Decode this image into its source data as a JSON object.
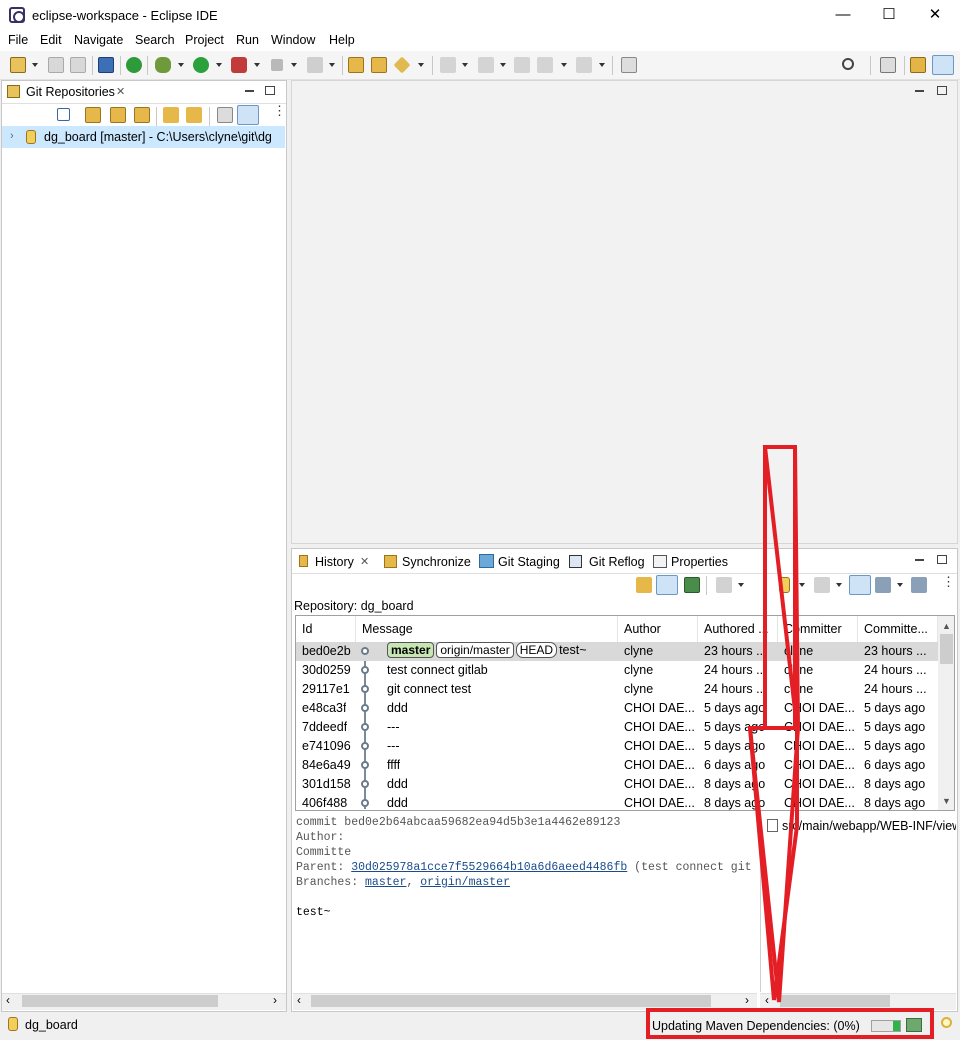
{
  "window": {
    "title": "eclipse-workspace - Eclipse IDE",
    "minimize": "—",
    "maximize": "☐",
    "close": "✕"
  },
  "menu": [
    "File",
    "Edit",
    "Navigate",
    "Search",
    "Project",
    "Run",
    "Window",
    "Help"
  ],
  "left_panel": {
    "tab_title": "Git Repositories",
    "tab_close": "✕",
    "repo_item": "dg_board [master] - C:\\Users\\clyne\\git\\dg"
  },
  "history": {
    "tabs": [
      "History",
      "Synchronize",
      "Git Staging",
      "Git Reflog",
      "Properties"
    ],
    "repository_label": "Repository: dg_board",
    "columns": [
      "Id",
      "Message",
      "Author",
      "Authored ...",
      "Committer",
      "Committe..."
    ],
    "rows": [
      {
        "id": "bed0e2b",
        "refs": [
          "master",
          "origin/master",
          "HEAD"
        ],
        "message": "test~",
        "author": "clyne",
        "authored": "23 hours ...",
        "committer": "clyne",
        "committed": "23 hours ..."
      },
      {
        "id": "30d0259",
        "refs": [],
        "message": "test connect gitlab",
        "author": "clyne",
        "authored": "24 hours ...",
        "committer": "clyne",
        "committed": "24 hours ..."
      },
      {
        "id": "29117e1",
        "refs": [],
        "message": "git connect test",
        "author": "clyne",
        "authored": "24 hours ...",
        "committer": "clyne",
        "committed": "24 hours ..."
      },
      {
        "id": "e48ca3f",
        "refs": [],
        "message": "ddd",
        "author": "CHOI DAE...",
        "authored": "5 days ago",
        "committer": "CHOI DAE...",
        "committed": "5 days ago"
      },
      {
        "id": "7ddeedf",
        "refs": [],
        "message": "---",
        "author": "CHOI DAE...",
        "authored": "5 days ago",
        "committer": "CHOI DAE...",
        "committed": "5 days ago"
      },
      {
        "id": "e741096",
        "refs": [],
        "message": "---",
        "author": "CHOI DAE...",
        "authored": "5 days ago",
        "committer": "CHOI DAE...",
        "committed": "5 days ago"
      },
      {
        "id": "84e6a49",
        "refs": [],
        "message": "ffff",
        "author": "CHOI DAE...",
        "authored": "6 days ago",
        "committer": "CHOI DAE...",
        "committed": "6 days ago"
      },
      {
        "id": "301d158",
        "refs": [],
        "message": "ddd",
        "author": "CHOI DAE...",
        "authored": "8 days ago",
        "committer": "CHOI DAE...",
        "committed": "8 days ago"
      },
      {
        "id": "406f488",
        "refs": [],
        "message": "ddd",
        "author": "CHOI DAE...",
        "authored": "8 days ago",
        "committer": "CHOI DAE...",
        "committed": "8 days ago"
      }
    ],
    "detail": {
      "commit_line": "commit bed0e2b64abcaa59682ea94d5b3e1a4462e89123",
      "author_label": "Author:",
      "committer_label": "Committe",
      "parent_label": "Parent:",
      "parent_hash": "30d025978a1cce7f5529664b10a6d6aeed4486fb",
      "parent_note": "(test connect git",
      "branches_label": "Branches:",
      "branch_master": "master",
      "branch_sep": ", ",
      "branch_origin": "origin/master",
      "message": "test~"
    },
    "file_path": "src/main/webapp/WEB-INF/view"
  },
  "status": {
    "selection": "dg_board",
    "progress_text": "Updating Maven Dependencies: (0%)",
    "progress_fraction": 0
  },
  "colors": {
    "selection": "#cce8ff",
    "annotation": "#e31e24",
    "badge_green": "#c7e6b3"
  }
}
